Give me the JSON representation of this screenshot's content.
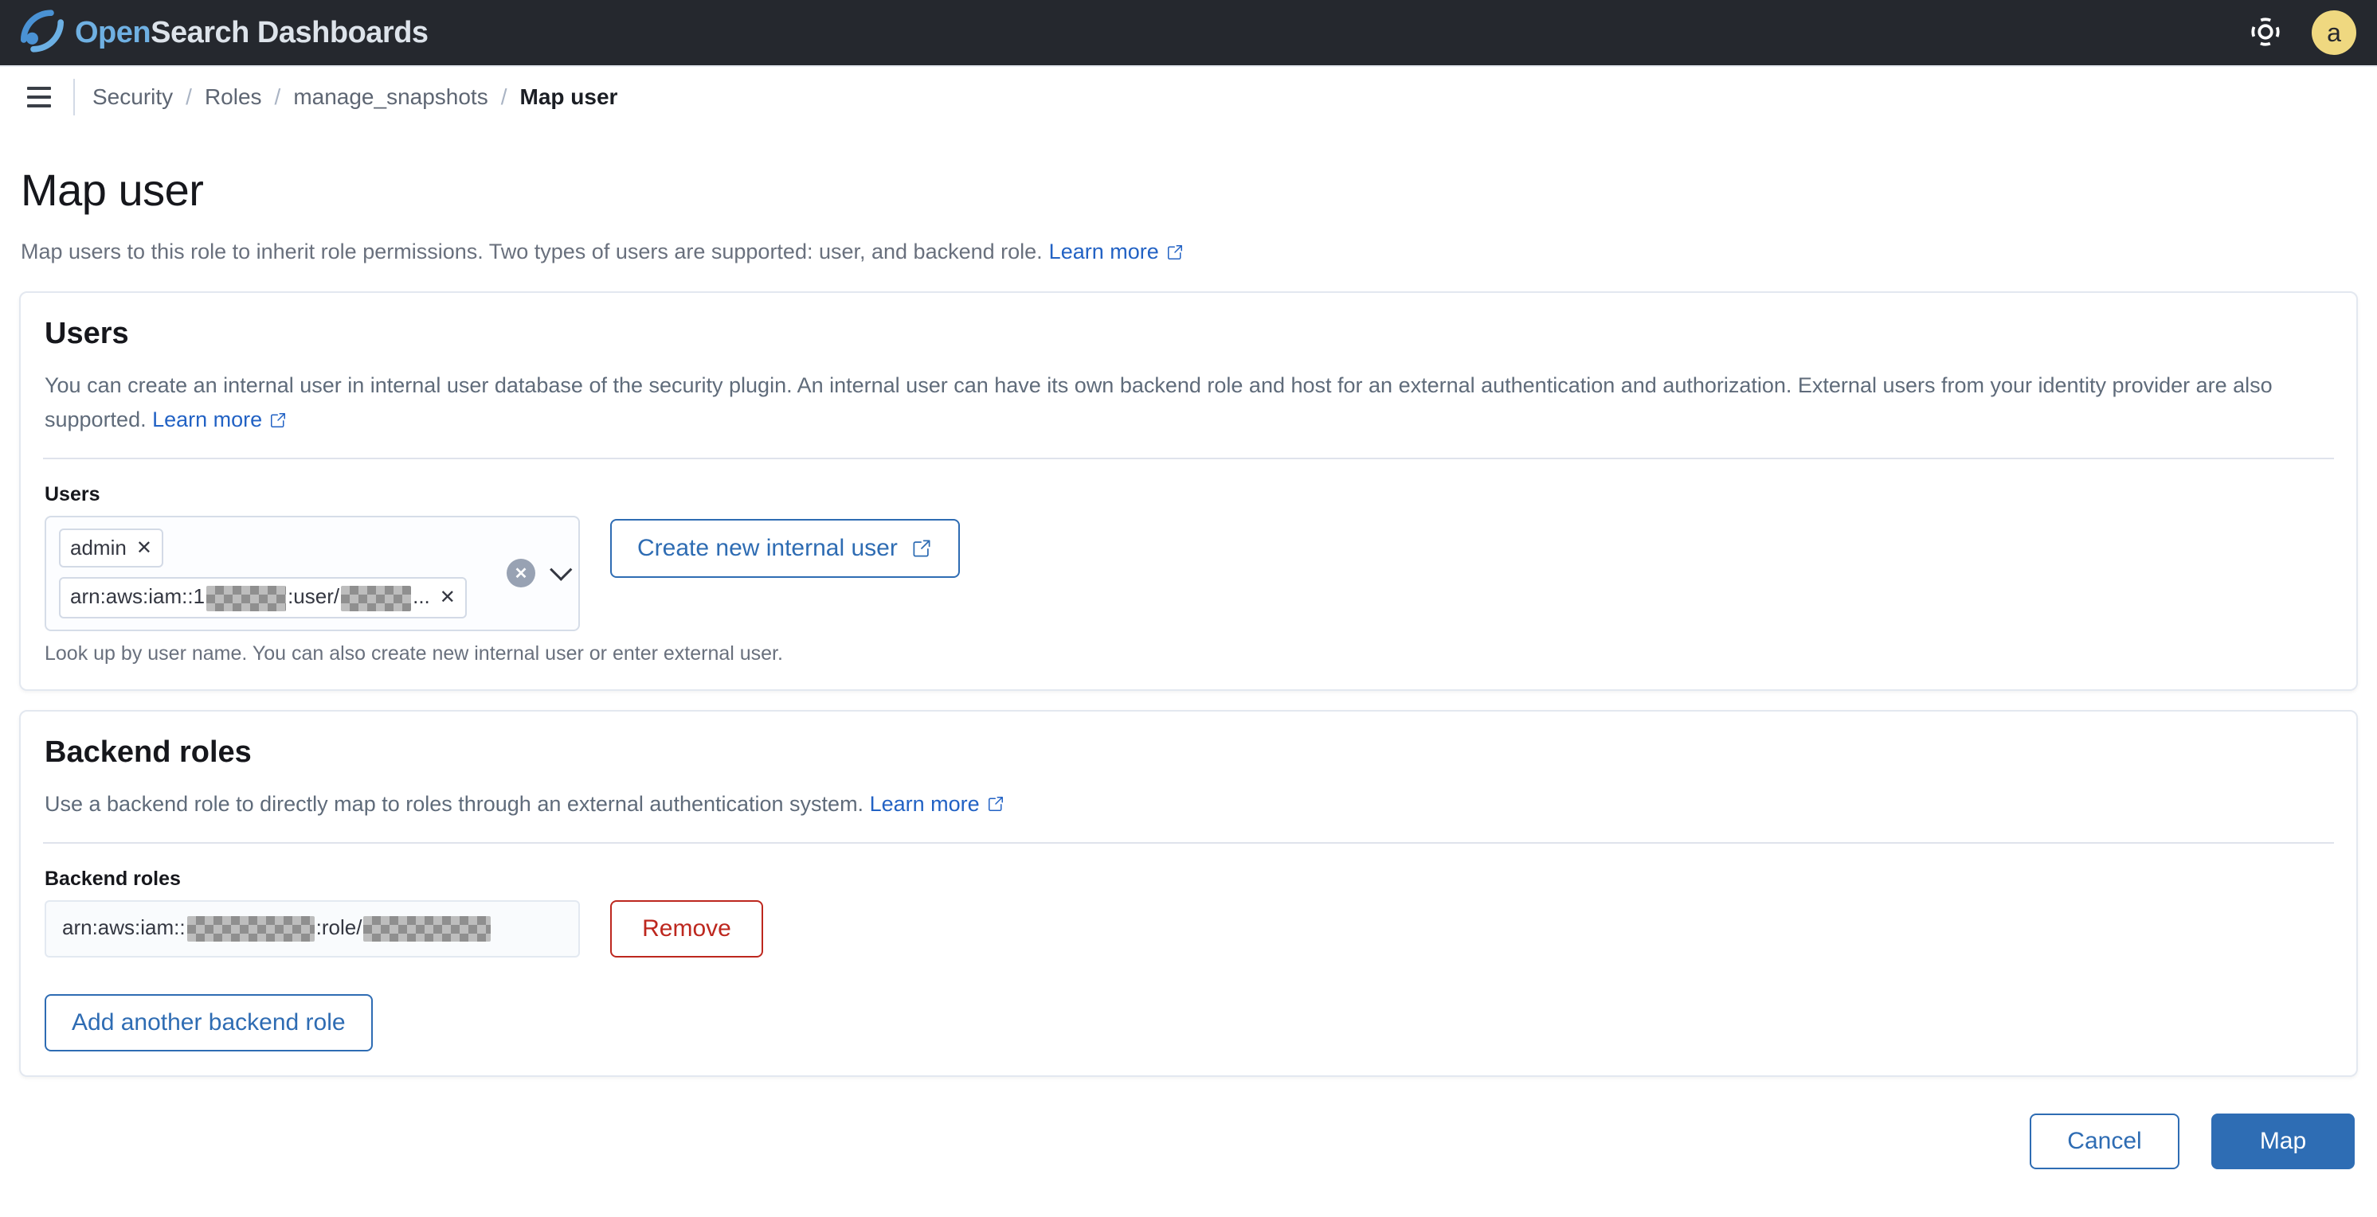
{
  "header": {
    "logo_open": "Open",
    "logo_search": "Search",
    "logo_suffix": " Dashboards",
    "avatar_letter": "a"
  },
  "breadcrumbs": {
    "items": [
      "Security",
      "Roles",
      "manage_snapshots"
    ],
    "current": "Map user",
    "separator": "/"
  },
  "page": {
    "title": "Map user",
    "subtitle": "Map users to this role to inherit role permissions. Two types of users are supported: user, and backend role.",
    "learn_more": "Learn more"
  },
  "users_panel": {
    "title": "Users",
    "description": "You can create an internal user in internal user database of the security plugin. An internal user can have its own backend role and host for an external authentication and authorization. External users from your identity provider are also supported.",
    "learn_more": "Learn more",
    "field_label": "Users",
    "pill_admin_segments": [
      {
        "text": "admin"
      }
    ],
    "pill_arn_segments": [
      {
        "text": "arn:aws:iam::1"
      },
      {
        "redacted": true,
        "width": 100
      },
      {
        "text": ":user/"
      },
      {
        "redacted": true,
        "width": 88
      },
      {
        "text": "..."
      }
    ],
    "remove_pill_label": "✕",
    "create_button": "Create new internal user",
    "help_text": "Look up by user name. You can also create new internal user or enter external user."
  },
  "backend_panel": {
    "title": "Backend roles",
    "description": "Use a backend role to directly map to roles through an external authentication system.",
    "learn_more": "Learn more",
    "field_label": "Backend roles",
    "role_value_segments": [
      {
        "text": "arn:aws:iam::"
      },
      {
        "redacted": true,
        "width": 160
      },
      {
        "text": ":role/"
      },
      {
        "redacted": true,
        "width": 160
      }
    ],
    "remove_button": "Remove",
    "add_button": "Add another backend role"
  },
  "footer": {
    "cancel": "Cancel",
    "map": "Map"
  },
  "colors": {
    "primary": "#2e6cb3",
    "primary_fill": "#2e6db4",
    "link": "#2262c4",
    "danger": "#bd271e",
    "header_bg": "#25282e",
    "avatar_bg": "#efd880"
  }
}
